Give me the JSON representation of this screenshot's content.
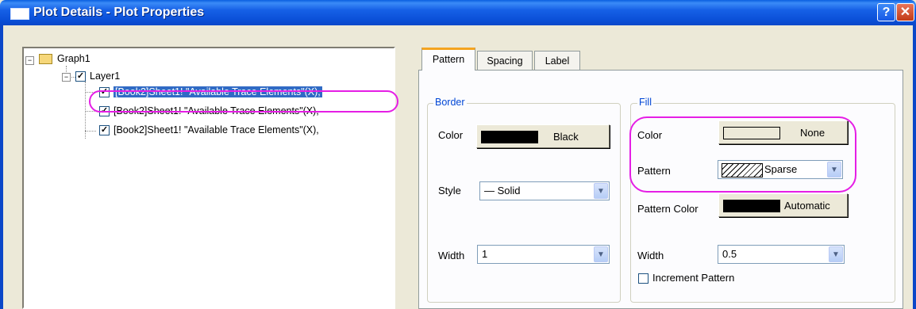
{
  "window": {
    "title": "Plot Details - Plot Properties",
    "help_label": "?",
    "close_label": "✕"
  },
  "tree": {
    "root": {
      "label": "Graph1"
    },
    "layer": {
      "label": "Layer1",
      "checked": true
    },
    "plots": [
      {
        "label": "[Book2]Sheet1! \"Available Trace Elements\"(X),",
        "checked": true,
        "selected": true
      },
      {
        "label": "[Book2]Sheet1! \"Available Trace Elements\"(X),",
        "checked": true,
        "selected": false
      },
      {
        "label": "[Book2]Sheet1! \"Available Trace Elements\"(X),",
        "checked": true,
        "selected": false
      }
    ]
  },
  "tabs": [
    {
      "label": "Pattern",
      "active": true
    },
    {
      "label": "Spacing",
      "active": false
    },
    {
      "label": "Label",
      "active": false
    }
  ],
  "border": {
    "title": "Border",
    "color_label": "Color",
    "color_value": "Black",
    "color_swatch": "#000000",
    "style_label": "Style",
    "style_value": "— Solid",
    "width_label": "Width",
    "width_value": "1"
  },
  "fill": {
    "title": "Fill",
    "color_label": "Color",
    "color_value": "None",
    "color_swatch": "#ece9d8",
    "pattern_label": "Pattern",
    "pattern_value": "Sparse",
    "pattern_color_label": "Pattern Color",
    "pattern_color_value": "Automatic",
    "pattern_color_swatch": "#000000",
    "width_label": "Width",
    "width_value": "0.5",
    "increment_label": "Increment Pattern",
    "increment_checked": false
  },
  "colors": {
    "highlight": "#e51ee5",
    "title_bar": "#0b47c8",
    "selection": "#316ac5"
  }
}
